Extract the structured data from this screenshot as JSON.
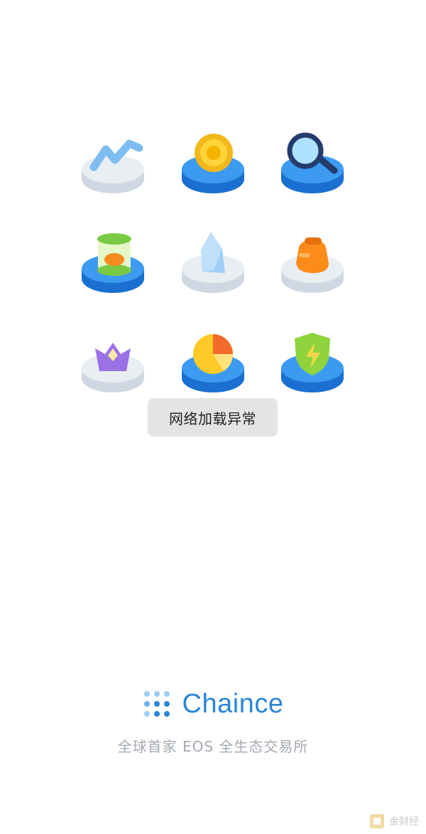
{
  "toast": {
    "message": "网络加载异常"
  },
  "brand": {
    "name": "Chaince",
    "tagline": "全球首家 EOS 全生态交易所",
    "accent_color": "#2b86d6"
  },
  "watermark": {
    "text": "金财经"
  },
  "icons": [
    "trend-icon",
    "coin-icon",
    "magnifier-icon",
    "jar-icon",
    "crystal-icon",
    "bag-icon",
    "crown-icon",
    "pie-chart-icon",
    "shield-lightning-icon"
  ]
}
